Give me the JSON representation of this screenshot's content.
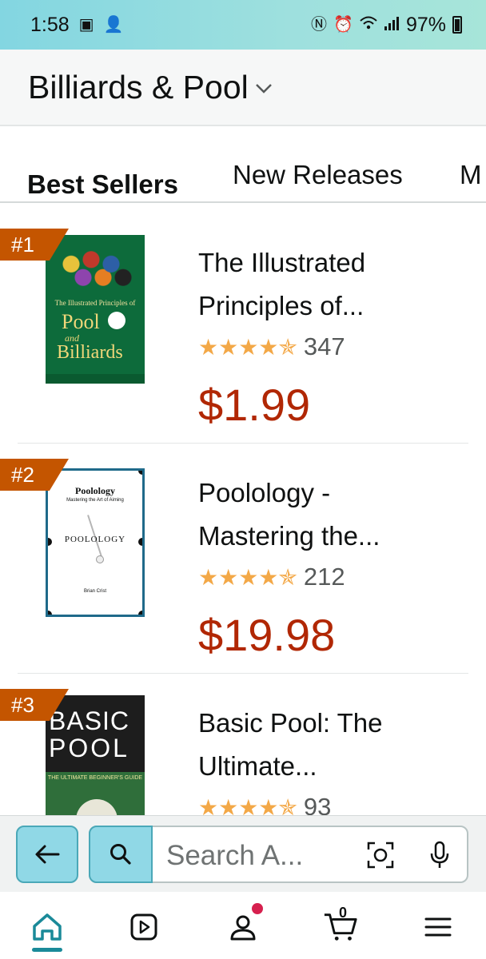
{
  "status_bar": {
    "time": "1:58",
    "battery": "97%"
  },
  "header": {
    "title": "Billiards & Pool"
  },
  "tabs": [
    {
      "label": "Best Sellers",
      "active": true
    },
    {
      "label": "New Releases",
      "active": false
    },
    {
      "label": "M",
      "active": false
    }
  ],
  "products": [
    {
      "rank": "#1",
      "title_line1": "The Illustrated",
      "title_line2": "Principles of...",
      "stars": "★★★★✯",
      "rating": 4.5,
      "review_count": "347",
      "price": "$1.99",
      "cover": {
        "line1": "The Illustrated Principles of",
        "line2": "Pool",
        "line3": "and",
        "line4": "Billiards"
      }
    },
    {
      "rank": "#2",
      "title_line1": "Poolology -",
      "title_line2": "Mastering the...",
      "stars": "★★★★✯",
      "rating": 4.5,
      "review_count": "212",
      "price": "$19.98",
      "cover": {
        "line1": "Poolology",
        "line1_sub": "Mastering the Art of Aiming",
        "line2": "POOLOLOGY",
        "line3": "Brian Crist"
      }
    },
    {
      "rank": "#3",
      "title_line1": "Basic Pool: The",
      "title_line2": "Ultimate...",
      "stars": "★★★★✯",
      "rating": 4.5,
      "review_count": "93",
      "price": "",
      "cover": {
        "line1": "BASIC",
        "line2": "POOL",
        "line3": "THE ULTIMATE BEGINNER'S GUIDE"
      }
    }
  ],
  "search": {
    "placeholder": "Search A..."
  },
  "bottom_nav": {
    "cart_count": "0"
  },
  "colors": {
    "accent": "#90d8e6",
    "rank_badge": "#c45500",
    "price": "#b12704",
    "stars": "#f3a847"
  }
}
